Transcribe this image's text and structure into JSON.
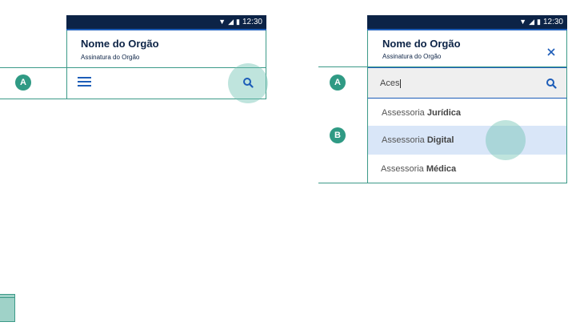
{
  "status_bar": {
    "time": "12:30"
  },
  "header": {
    "title": "Nome do Orgão",
    "subtitle": "Assinatura do Orgão"
  },
  "markers": {
    "a": "A",
    "b": "B"
  },
  "search": {
    "typed_value": "Aces"
  },
  "suggestions": [
    {
      "prefix": "Assessoria",
      "bold": "Jurídica",
      "selected": false
    },
    {
      "prefix": "Assessoria",
      "bold": "Digital",
      "selected": true
    },
    {
      "prefix": "Assessoria",
      "bold": "Médica",
      "selected": false
    }
  ],
  "icons": {
    "search": "search-icon",
    "menu": "menu-icon",
    "close": "close-icon",
    "wifi": "wifi-icon",
    "signal": "signal-icon",
    "battery": "battery-icon"
  },
  "colors": {
    "status_bar": "#0c2346",
    "accent_blue": "#1d5db8",
    "guide_green": "#3c9a88",
    "marker_green": "#2f9a84",
    "selected_row": "#d9e6f8"
  }
}
